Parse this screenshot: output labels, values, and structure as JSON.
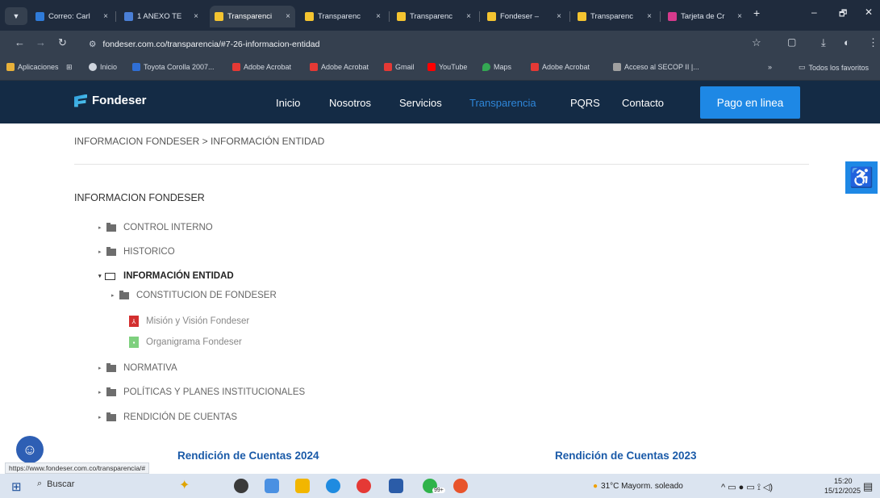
{
  "browser": {
    "tabs": [
      {
        "label": "Correo: Carl",
        "color": "#2f7bd9",
        "active": false
      },
      {
        "label": "1 ANEXO TE",
        "color": "#4a7fd6",
        "active": false
      },
      {
        "label": "Transparenci",
        "color": "#f4c430",
        "active": true
      },
      {
        "label": "Transparenc",
        "color": "#f4c430",
        "active": false
      },
      {
        "label": "Transparenc",
        "color": "#f4c430",
        "active": false
      },
      {
        "label": "Fondeser –",
        "color": "#f4c430",
        "active": false
      },
      {
        "label": "Transparenc",
        "color": "#f4c430",
        "active": false
      },
      {
        "label": "Tarjeta de Cr",
        "color": "#d63a8c",
        "active": false
      }
    ],
    "tab_close": "×",
    "new_tab": "+",
    "window_controls": {
      "minimize": "–",
      "restore": "🗗",
      "close": "✕"
    },
    "url": "fondeser.com.co/transparencia/#7-26-informacion-entidad",
    "bookmarks": [
      {
        "label": "Aplicaciones",
        "color": "#e8b13a"
      },
      {
        "label": "Inicio",
        "color": "#cfd5de"
      },
      {
        "label": "Toyota Corolla 2007...",
        "color": "#2f6fd6"
      },
      {
        "label": "Adobe Acrobat",
        "color": "#e53935"
      },
      {
        "label": "Adobe Acrobat",
        "color": "#e53935"
      },
      {
        "label": "Gmail",
        "color": "#e53935"
      },
      {
        "label": "YouTube",
        "color": "#ff0000"
      },
      {
        "label": "Maps",
        "color": "#34a853"
      },
      {
        "label": "Adobe Acrobat",
        "color": "#e53935"
      },
      {
        "label": "Acceso al SECOP II |...",
        "color": "#a0a0a0"
      }
    ],
    "bookmarks_overflow": "»",
    "all_bookmarks": "Todos los favoritos"
  },
  "site": {
    "brand": "Fondeser",
    "nav": [
      {
        "label": "Inicio",
        "current": false
      },
      {
        "label": "Nosotros",
        "current": false
      },
      {
        "label": "Servicios",
        "current": false
      },
      {
        "label": "Transparencia",
        "current": true
      },
      {
        "label": "PQRS",
        "current": false
      },
      {
        "label": "Contacto",
        "current": false
      }
    ],
    "pay_button": "Pago en linea",
    "breadcrumb": "INFORMACION FONDESER  >  INFORMACIÓN ENTIDAD",
    "section_title": "INFORMACION FONDESER",
    "tree": [
      {
        "label": "CONTROL INTERNO"
      },
      {
        "label": "HISTORICO"
      },
      {
        "label": "INFORMACIÓN ENTIDAD"
      },
      {
        "label": "CONSTITUCION DE FONDESER"
      },
      {
        "label": "Misión y Visión Fondeser",
        "doc_color": "#d32f2f"
      },
      {
        "label": "Organigrama Fondeser",
        "doc_color": "#7ed07e"
      },
      {
        "label": "NORMATIVA"
      },
      {
        "label": "POLÍTICAS Y PLANES INSTITUCIONALES"
      },
      {
        "label": "RENDICIÓN DE CUENTAS"
      }
    ],
    "rendicion_2024": "Rendición de Cuentas 2024",
    "rendicion_2023": "Rendición de Cuentas 2023",
    "status_url": "https://www.fondeser.com.co/transparencia/#"
  },
  "taskbar": {
    "search": "Buscar",
    "weather": "31°C  Mayorm. soleado",
    "time": "15:20",
    "date": "15/12/2025",
    "badge": "99+"
  }
}
